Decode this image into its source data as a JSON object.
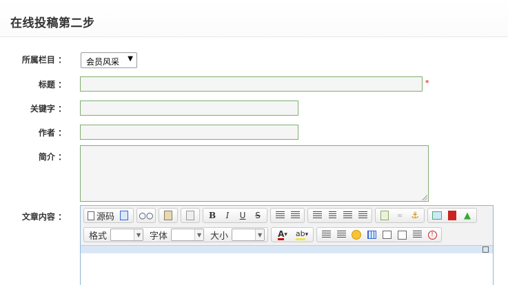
{
  "header": {
    "title": "在线投稿第二步"
  },
  "form": {
    "category": {
      "label": "所属栏目 ：",
      "value": "会员风采"
    },
    "title": {
      "label": "标题 ：",
      "value": "",
      "required_mark": "*"
    },
    "keywords": {
      "label": "关键字 ：",
      "value": ""
    },
    "author": {
      "label": "作者 ：",
      "value": ""
    },
    "summary": {
      "label": "简介 ：",
      "value": ""
    },
    "content": {
      "label": "文章内容 ："
    }
  },
  "editor": {
    "source_label": "源码",
    "format_label": "格式",
    "font_label": "字体",
    "size_label": "大小",
    "bold": "B",
    "italic": "I",
    "underline": "U",
    "strike": "S",
    "font_color_glyph": "A",
    "bg_color_glyph": "ab",
    "info_glyph": "!"
  }
}
